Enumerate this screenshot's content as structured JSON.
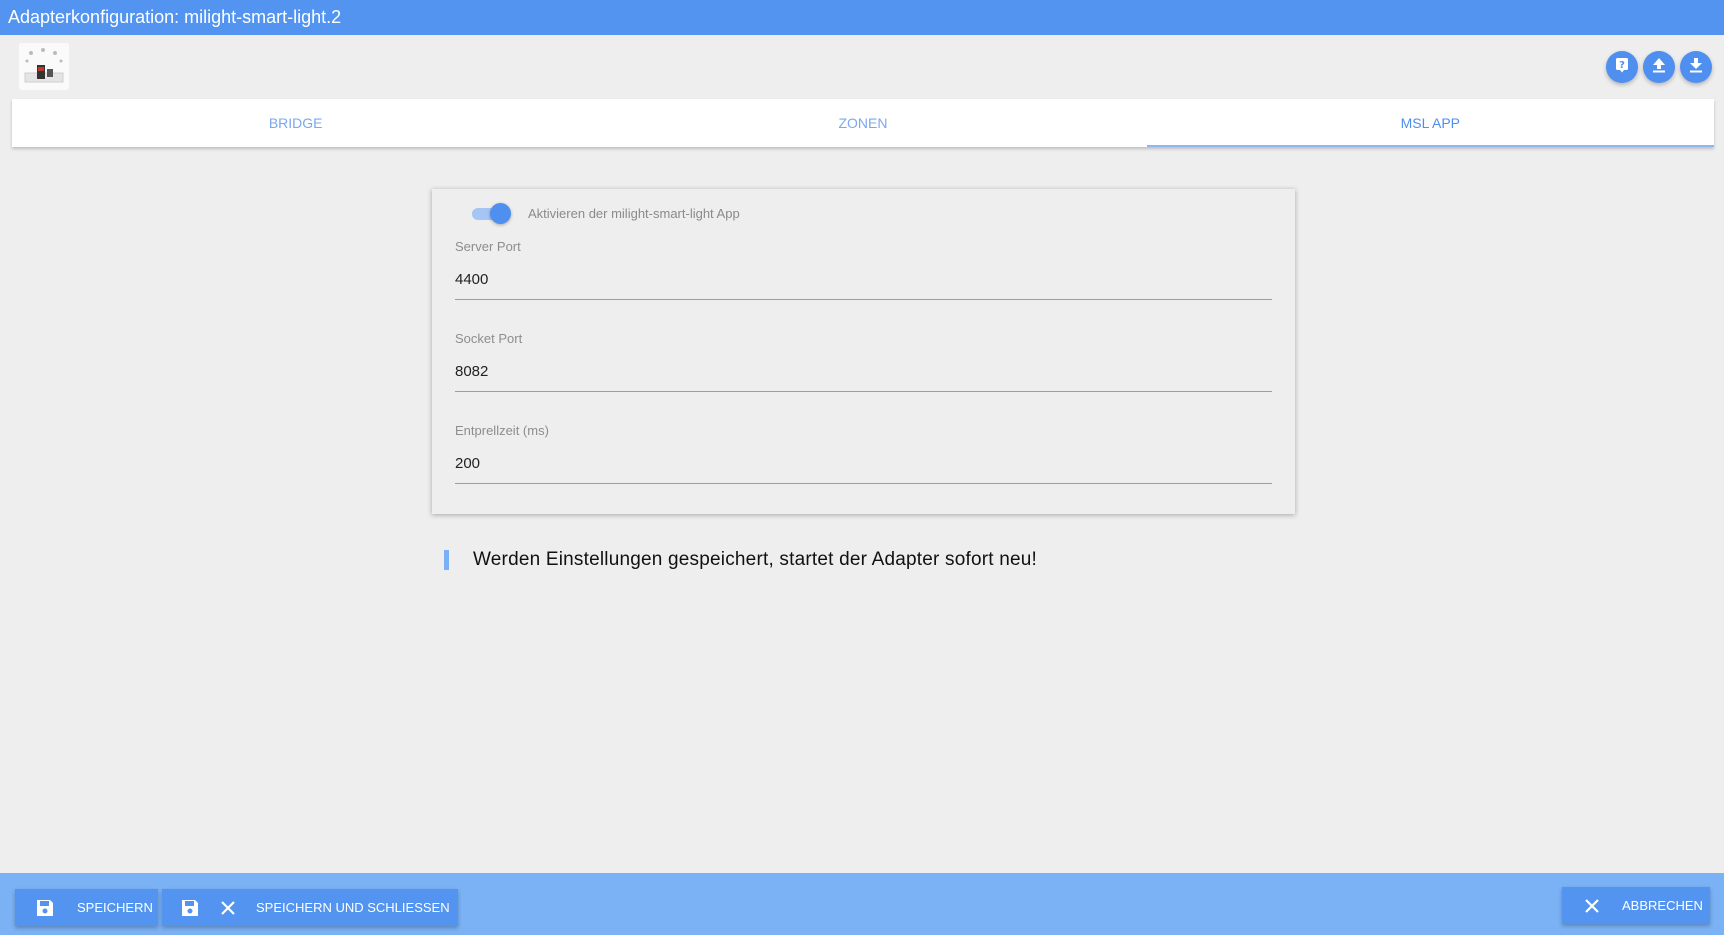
{
  "window": {
    "title": "Adapterkonfiguration: milight-smart-light.2"
  },
  "header": {
    "logo_icon": "adapter-logo-image",
    "actions": [
      {
        "icon": "help-icon"
      },
      {
        "icon": "upload-icon"
      },
      {
        "icon": "download-icon"
      }
    ]
  },
  "tabs": [
    {
      "label": "BRIDGE",
      "active": false
    },
    {
      "label": "ZONEN",
      "active": false
    },
    {
      "label": "MSL APP",
      "active": true
    }
  ],
  "settings": {
    "enable_app": {
      "label": "Aktivieren der milight-smart-light App",
      "checked": true
    },
    "server_port": {
      "label": "Server Port",
      "value": "4400"
    },
    "socket_port": {
      "label": "Socket Port",
      "value": "8082"
    },
    "debounce": {
      "label": "Entprellzeit (ms)",
      "value": "200"
    }
  },
  "notice": "Werden Einstellungen gespeichert, startet der Adapter sofort neu!",
  "footer": {
    "save_label": "SPEICHERN",
    "save_close_label": "SPEICHERN UND SCHLIESSEN",
    "cancel_label": "ABBRECHEN"
  },
  "colors": {
    "primary": "#5294f0",
    "footer": "#7ab2f5",
    "background": "#eeeeee"
  }
}
